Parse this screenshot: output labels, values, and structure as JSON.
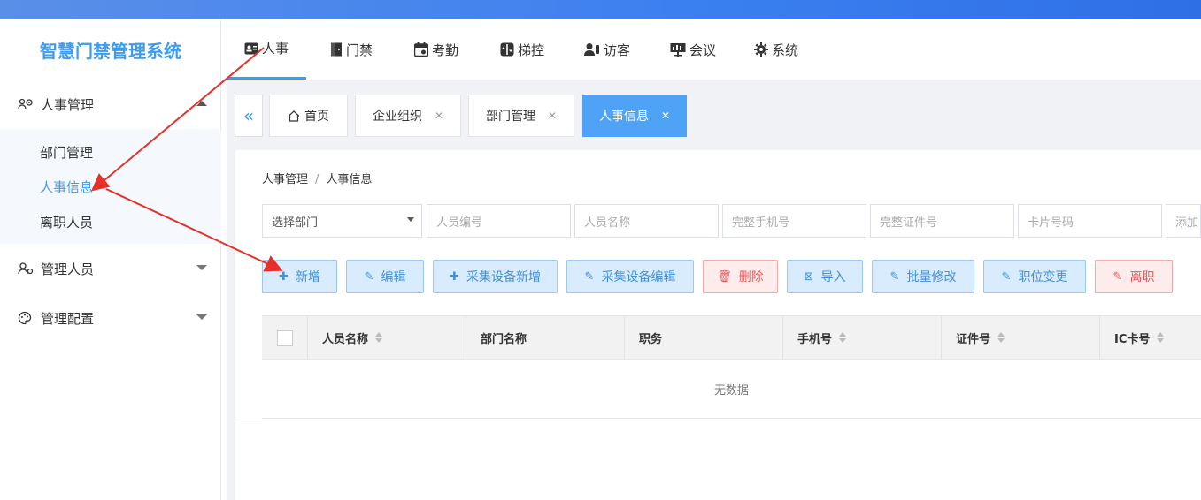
{
  "app": {
    "title": "智慧门禁管理系统"
  },
  "sidebar": {
    "groups": [
      {
        "label": "人事管理",
        "icon": "users-gear-icon",
        "expanded": true
      },
      {
        "label": "管理人员",
        "icon": "user-gear-icon",
        "expanded": false
      },
      {
        "label": "管理配置",
        "icon": "palette-icon",
        "expanded": false
      }
    ],
    "subitems": [
      {
        "label": "部门管理",
        "active": false
      },
      {
        "label": "人事信息",
        "active": true
      },
      {
        "label": "离职人员",
        "active": false
      }
    ]
  },
  "topnav": {
    "items": [
      {
        "label": "人事",
        "icon": "id-card-icon",
        "active": true
      },
      {
        "label": "门禁",
        "icon": "door-icon",
        "active": false
      },
      {
        "label": "考勤",
        "icon": "calendar-icon",
        "active": false
      },
      {
        "label": "梯控",
        "icon": "elevator-icon",
        "active": false
      },
      {
        "label": "访客",
        "icon": "visitor-icon",
        "active": false
      },
      {
        "label": "会议",
        "icon": "meeting-icon",
        "active": false
      },
      {
        "label": "系统",
        "icon": "gear-icon",
        "active": false
      }
    ]
  },
  "tabs": [
    {
      "label": "首页",
      "icon": "home-icon",
      "closable": false,
      "active": false
    },
    {
      "label": "企业组织",
      "closable": true,
      "active": false
    },
    {
      "label": "部门管理",
      "closable": true,
      "active": false
    },
    {
      "label": "人事信息",
      "closable": true,
      "active": true
    }
  ],
  "breadcrumb": {
    "parent": "人事管理",
    "separator": "/",
    "current": "人事信息"
  },
  "filters": [
    {
      "placeholder": "选择部门",
      "type": "select"
    },
    {
      "placeholder": "人员编号"
    },
    {
      "placeholder": "人员名称"
    },
    {
      "placeholder": "完整手机号"
    },
    {
      "placeholder": "完整证件号"
    },
    {
      "placeholder": "卡片号码"
    },
    {
      "placeholder": "添加"
    }
  ],
  "buttons": [
    {
      "label": "新增",
      "icon": "plus-icon",
      "style": "primary"
    },
    {
      "label": "编辑",
      "icon": "edit-icon",
      "style": "primary"
    },
    {
      "label": "采集设备新增",
      "icon": "plus-icon",
      "style": "primary"
    },
    {
      "label": "采集设备编辑",
      "icon": "edit-icon",
      "style": "primary"
    },
    {
      "label": "删除",
      "icon": "trash-icon",
      "style": "danger"
    },
    {
      "label": "导入",
      "icon": "import-icon",
      "style": "primary"
    },
    {
      "label": "批量修改",
      "icon": "edit-icon",
      "style": "primary"
    },
    {
      "label": "职位变更",
      "icon": "edit-icon",
      "style": "primary"
    },
    {
      "label": "离职",
      "icon": "edit-icon",
      "style": "danger"
    }
  ],
  "table": {
    "columns": [
      {
        "label": "人员名称",
        "sortable": true
      },
      {
        "label": "部门名称",
        "sortable": false
      },
      {
        "label": "职务",
        "sortable": false
      },
      {
        "label": "手机号",
        "sortable": true
      },
      {
        "label": "证件号",
        "sortable": true
      },
      {
        "label": "IC卡号",
        "sortable": true
      }
    ],
    "rows": [],
    "empty_text": "无数据"
  },
  "colors": {
    "accent": "#3f9bf0",
    "topbar": "#3a7ff0",
    "danger": "#e65b5b",
    "annotation": "#e8302a"
  }
}
